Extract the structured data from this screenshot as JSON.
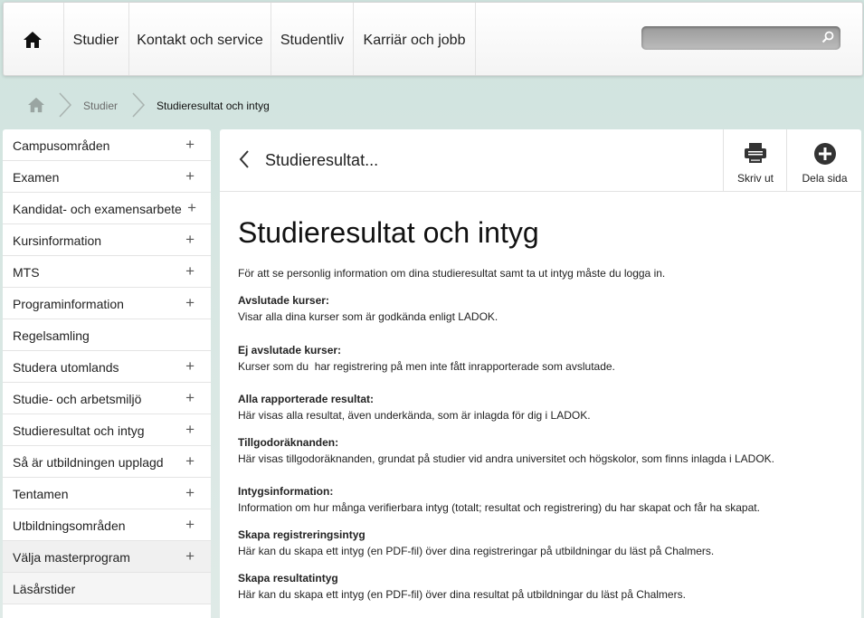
{
  "topnav": {
    "items": [
      "Studier",
      "Kontakt och service",
      "Studentliv",
      "Karriär och jobb"
    ],
    "search_placeholder": ""
  },
  "breadcrumb": {
    "items": [
      "Studier",
      "Studieresultat och intyg"
    ]
  },
  "sidebar": {
    "items": [
      {
        "label": "Campusområden",
        "plus": "+"
      },
      {
        "label": "Examen",
        "plus": "+"
      },
      {
        "label": "Kandidat- och examensarbete",
        "plus": "+"
      },
      {
        "label": "Kursinformation",
        "plus": "+"
      },
      {
        "label": "MTS",
        "plus": "+"
      },
      {
        "label": "Programinformation",
        "plus": "+"
      },
      {
        "label": "Regelsamling",
        "plus": ""
      },
      {
        "label": "Studera utomlands",
        "plus": "+"
      },
      {
        "label": "Studie- och arbetsmiljö",
        "plus": "+"
      },
      {
        "label": "Studieresultat och intyg",
        "plus": "+"
      },
      {
        "label": "Så är utbildningen upplagd",
        "plus": "+"
      },
      {
        "label": "Tentamen",
        "plus": "+"
      },
      {
        "label": "Utbildningsområden",
        "plus": "+"
      },
      {
        "label": "Välja masterprogram",
        "plus": "+"
      },
      {
        "label": "Läsårstider",
        "plus": ""
      }
    ]
  },
  "content": {
    "header_title": "Studieresultat...",
    "print_label": "Skriv ut",
    "share_label": "Dela sida",
    "page_title": "Studieresultat och intyg",
    "intro": "För att se personlig information om dina studieresultat samt ta ut intyg måste du logga in.",
    "sections": [
      {
        "heading": "Avslutade kurser:",
        "text": "Visar alla dina kurser som är godkända enligt LADOK."
      },
      {
        "heading": "Ej avslutade kurser:",
        "text": "Kurser som du  har registrering på men inte fått inrapporterade som avslutade."
      },
      {
        "heading": "Alla rapporterade resultat:",
        "text": "Här visas alla resultat, även underkända, som är inlagda för dig i LADOK."
      },
      {
        "heading": "Tillgodoräknanden:",
        "text": "Här visas tillgodoräknanden, grundat på studier vid andra universitet och högskolor, som finns inlagda i LADOK."
      },
      {
        "heading": "Intygsinformation:",
        "text": "Information om hur många verifierbara intyg (totalt; resultat och registrering) du har skapat och får ha skapat."
      },
      {
        "heading": "Skapa registreringsintyg",
        "text": "Här kan du skapa ett intyg (en PDF-fil) över dina registreringar på utbildningar du läst på Chalmers."
      },
      {
        "heading": "Skapa resultatintyg",
        "text": "Här kan du skapa ett intyg (en PDF-fil) över dina resultat på utbildningar du läst på Chalmers."
      }
    ]
  },
  "colors": {
    "background": "#d7e6e2",
    "panel": "#ffffff",
    "text": "#222222"
  }
}
